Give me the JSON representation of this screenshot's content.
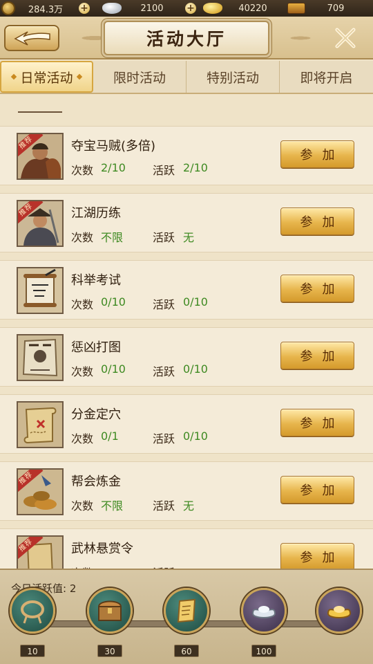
{
  "currency": {
    "copper": {
      "value": "284.3万",
      "icon": "copper-coin-icon"
    },
    "silver": {
      "value": "2100",
      "icon": "silver-ingot-icon"
    },
    "gold": {
      "value": "40220",
      "icon": "gold-ingot-icon"
    },
    "box": {
      "value": "709",
      "icon": "treasure-box-icon"
    },
    "plus_label": "+"
  },
  "header": {
    "title": "活动大厅",
    "back_icon": "back-arrow-icon",
    "close_icon": "close-icon"
  },
  "tabs": [
    {
      "label": "日常活动",
      "active": true
    },
    {
      "label": "限时活动",
      "active": false
    },
    {
      "label": "特别活动",
      "active": false
    },
    {
      "label": "即将开启",
      "active": false
    }
  ],
  "labels": {
    "count": "次数",
    "activity": "活跃",
    "join": "参加",
    "recommend": "推荐"
  },
  "activities": [
    {
      "name": "夺宝马贼(多倍)",
      "count": "2/10",
      "activity": "2/10",
      "recommended": true
    },
    {
      "name": "江湖历练",
      "count": "不限",
      "activity": "无",
      "recommended": true
    },
    {
      "name": "科举考试",
      "count": "0/10",
      "activity": "0/10",
      "recommended": false
    },
    {
      "name": "惩凶打图",
      "count": "0/10",
      "activity": "0/10",
      "recommended": false
    },
    {
      "name": "分金定穴",
      "count": "0/1",
      "activity": "0/10",
      "recommended": false
    },
    {
      "name": "帮会炼金",
      "count": "不限",
      "activity": "无",
      "recommended": true
    },
    {
      "name": "武林悬赏令",
      "count": "",
      "activity": "",
      "recommended": true
    }
  ],
  "footer": {
    "activity_label": "今日活跃值:",
    "activity_value": "2",
    "milestones": [
      {
        "value": "10",
        "icon": "rope-icon"
      },
      {
        "value": "30",
        "icon": "chest-icon"
      },
      {
        "value": "60",
        "icon": "scroll-icon"
      },
      {
        "value": "100",
        "icon": "silver-ingot-icon"
      },
      {
        "value": "",
        "icon": "gold-ingot-icon"
      }
    ]
  },
  "colors": {
    "accent_green": "#3e8a22",
    "button_gold": "#e7b54c",
    "ribbon_red": "#b8322a"
  }
}
